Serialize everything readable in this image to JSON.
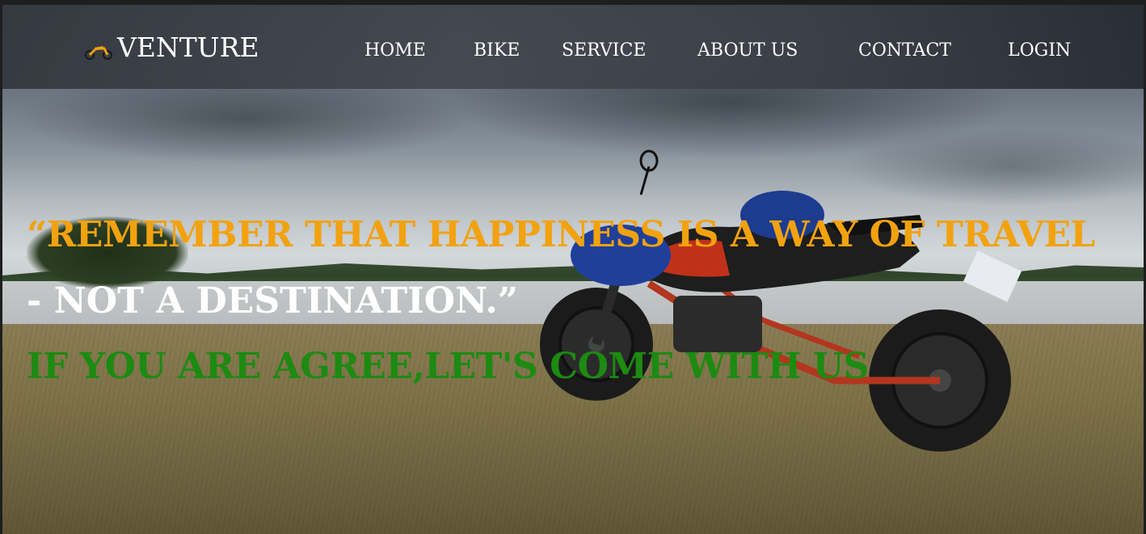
{
  "brand": {
    "name": "VENTURE",
    "icon": "motorbike-logo-icon"
  },
  "nav": {
    "items": [
      {
        "label": "HOME"
      },
      {
        "label": "BIKE"
      },
      {
        "label": "SERVICE"
      },
      {
        "label": "ABOUT US"
      },
      {
        "label": "CONTACT"
      },
      {
        "label": "LOGIN"
      }
    ]
  },
  "hero": {
    "quote_line1": "“REMEMBER THAT HAPPINESS IS A WAY OF TRAVEL",
    "quote_line2": "- NOT A DESTINATION.”",
    "cta": "IF YOU ARE AGREE,LET'S COME WITH US",
    "background": "motorcycle-on-grass-by-lake-photo"
  },
  "colors": {
    "quote_line1": "#f2a20f",
    "quote_line2": "#ffffff",
    "cta": "#1d8a12",
    "nav_text": "#ffffff"
  }
}
